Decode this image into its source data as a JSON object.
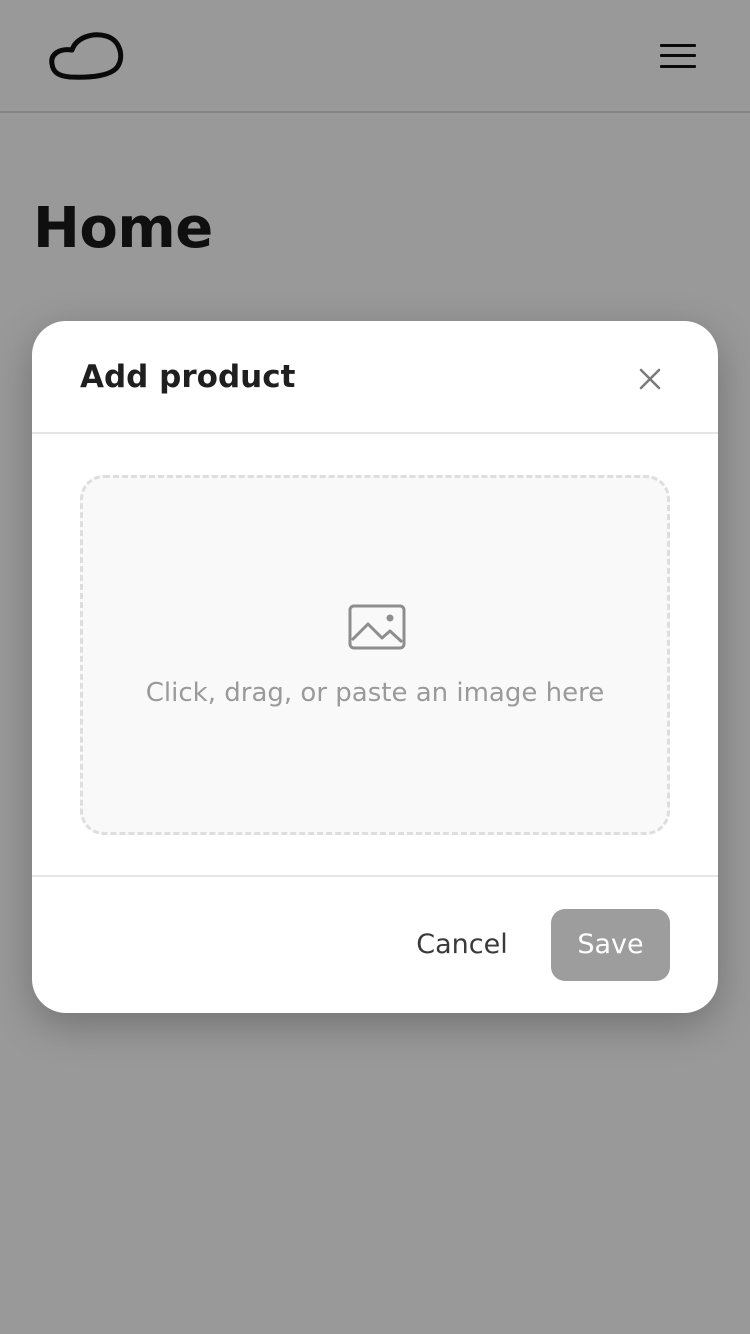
{
  "header": {
    "logo_icon": "cloud-logo-icon",
    "menu_icon": "hamburger-menu-icon"
  },
  "page": {
    "title": "Home"
  },
  "modal": {
    "title": "Add product",
    "close_icon": "close-icon",
    "dropzone": {
      "icon": "image-icon",
      "text": "Click, drag, or paste an image here"
    },
    "footer": {
      "cancel_label": "Cancel",
      "save_label": "Save"
    }
  },
  "colors": {
    "overlay": "#999999",
    "save_button_disabled": "#9d9d9d",
    "text_primary": "#1f1f1f",
    "text_muted": "#9a9a9a"
  }
}
